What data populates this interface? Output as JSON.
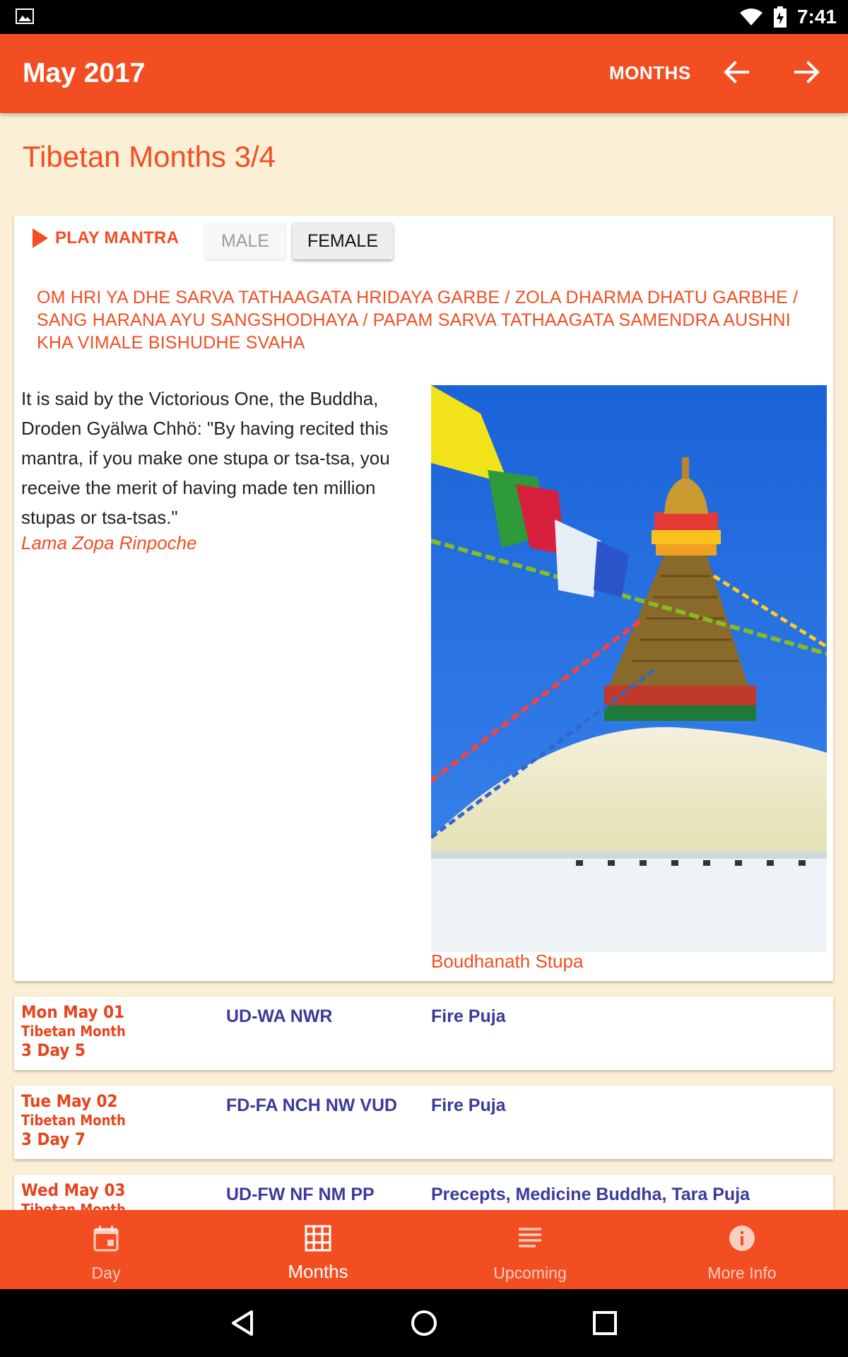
{
  "status_bar": {
    "time": "7:41"
  },
  "app_bar": {
    "title": "May 2017",
    "months_label": "MONTHS"
  },
  "section": {
    "title": "Tibetan Months 3/4"
  },
  "mantra_card": {
    "play_label": "PLAY MANTRA",
    "male_label": "MALE",
    "female_label": "FEMALE",
    "mantra_text": "OM HRI YA DHE SARVA TATHAAGATA HRIDAYA GARBE / ZOLA DHARMA DHATU GARBHE / SANG HARANA AYU SANGSHODHAYA / PAPAM SARVA TATHAAGATA SAMENDRA AUSHNI KHA VIMALE BISHUDHE SVAHA",
    "quote": "It is said by the Victorious One, the Buddha, Droden Gyälwa Chhö: \"By having recited this mantra, if you make one stupa or tsa-tsa, you receive the merit of having made ten million stupas or tsa-tsas.\"",
    "author": "Lama Zopa Rinpoche",
    "image_caption": "Boudhanath Stupa"
  },
  "days": [
    {
      "date": "Mon May 01",
      "tib_month": "Tibetan Month",
      "tib_day": "3 Day 5",
      "code": "UD-WA NWR",
      "event": "Fire Puja"
    },
    {
      "date": "Tue May 02",
      "tib_month": "Tibetan Month",
      "tib_day": "3 Day 7",
      "code": "FD-FA NCH NW VUD",
      "event": "Fire Puja"
    },
    {
      "date": "Wed May 03",
      "tib_month": "Tibetan Month",
      "tib_day": "",
      "code": "UD-FW NF NM PP",
      "event": "Precepts, Medicine Buddha, Tara Puja"
    }
  ],
  "bottom_nav": [
    {
      "label": "Day",
      "icon": "calendar-event-icon"
    },
    {
      "label": "Months",
      "icon": "grid-icon"
    },
    {
      "label": "Upcoming",
      "icon": "list-icon"
    },
    {
      "label": "More Info",
      "icon": "info-icon"
    }
  ],
  "colors": {
    "primary": "#f24e22",
    "background": "#fbefd6",
    "event_text": "#3b3b9a"
  }
}
